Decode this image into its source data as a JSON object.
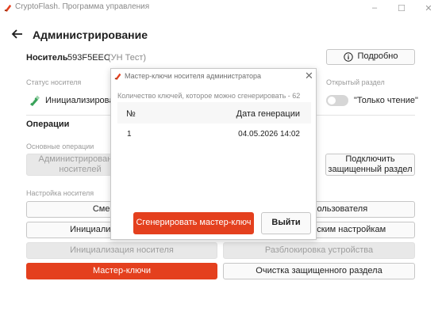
{
  "window": {
    "title": "CryptoFlash. Программа управления",
    "minimize": "–",
    "maximize": "☐",
    "close": "✕"
  },
  "header": {
    "title": "Администрирование"
  },
  "carrier": {
    "label": "Носитель",
    "id": "593F5EEC",
    "tag": "(УН Тест)",
    "details_button": "Подробно"
  },
  "status": {
    "label": "Статус носителя",
    "value": "Инициализирован"
  },
  "open_section": {
    "label": "Открытый раздел",
    "readonly_label": "\"Только чтение\"",
    "readonly_enabled": false
  },
  "operations": {
    "title": "Операции",
    "basic_label": "Основные операции",
    "admin_users_button": "Администрирование носителей",
    "connect_protected_button": "Подключить защищенный раздел",
    "settings_label": "Настройка носителя",
    "buttons": [
      {
        "label": "Смена пароля",
        "state": "normal"
      },
      {
        "label": "Создание пользователя",
        "state": "normal"
      },
      {
        "label": "Инициализация носителя",
        "state": "normal"
      },
      {
        "label": "Возврат к заводским настройкам",
        "state": "normal"
      },
      {
        "label": "Инициализация носителя",
        "state": "disabled"
      },
      {
        "label": "Разблокировка устройства",
        "state": "disabled"
      },
      {
        "label": "Мастер-ключи",
        "state": "active"
      },
      {
        "label": "Очистка защищенного раздела",
        "state": "normal"
      }
    ]
  },
  "dialog": {
    "title": "Мастер-ключи носителя администратора",
    "close": "✕",
    "count_text": "Количество ключей, которое можно сгенерировать - 62",
    "columns": {
      "num": "№",
      "date": "Дата генерации"
    },
    "rows": [
      {
        "num": "1",
        "date": "04.05.2026 14:02"
      }
    ],
    "generate_button": "Сгенерировать мастер-ключ",
    "exit_button": "Выйти"
  },
  "colors": {
    "accent": "#e4401e",
    "green": "#3aa35a"
  }
}
